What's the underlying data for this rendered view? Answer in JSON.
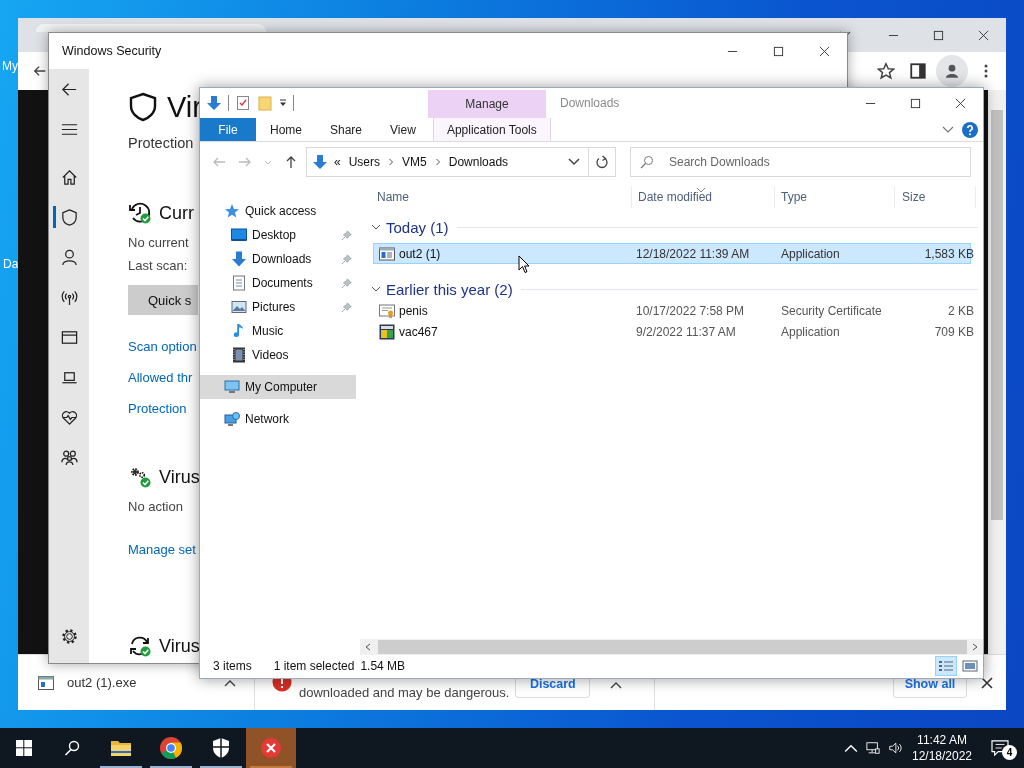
{
  "desktop": {
    "icon_labels": [
      "My",
      "Da"
    ]
  },
  "browser": {
    "download_bar": {
      "file_name": "out2 (1).exe",
      "warning": "downloaded and may be dangerous.",
      "discard": "Discard",
      "show_all": "Show all"
    }
  },
  "security": {
    "title": "Windows Security",
    "nav": [
      {
        "kind": "home",
        "selected": false
      },
      {
        "kind": "shield",
        "selected": true
      },
      {
        "kind": "person",
        "selected": false
      },
      {
        "kind": "antenna",
        "selected": false
      },
      {
        "kind": "window",
        "selected": false
      },
      {
        "kind": "laptop",
        "selected": false
      },
      {
        "kind": "heart",
        "selected": false
      },
      {
        "kind": "family",
        "selected": false
      }
    ],
    "heading": "Vir",
    "subtitle": "Protection",
    "sections": [
      {
        "kind": "history",
        "title": "Curr",
        "lines": [
          "No current",
          "Last scan:"
        ],
        "button": "Quick s",
        "links": [
          "Scan option",
          "Allowed thr",
          "Protection"
        ]
      },
      {
        "kind": "gears",
        "title": "Virus",
        "lines": [
          "No action"
        ],
        "links": [
          "Manage set"
        ]
      },
      {
        "kind": "sync",
        "title": "Virus"
      }
    ]
  },
  "explorer": {
    "title": "Downloads",
    "context_group": "Manage",
    "ribbon_tabs": [
      {
        "label": "File",
        "kind": "file"
      },
      {
        "label": "Home",
        "kind": "plain"
      },
      {
        "label": "Share",
        "kind": "plain"
      },
      {
        "label": "View",
        "kind": "plain"
      },
      {
        "label": "Application Tools",
        "kind": "context"
      }
    ],
    "address": {
      "overflow": "«",
      "path": [
        "Users",
        "VM5",
        "Downloads"
      ]
    },
    "search": {
      "placeholder": "Search Downloads"
    },
    "nav": [
      {
        "label": "Quick access",
        "kind": "star",
        "selected": false,
        "children": [
          {
            "label": "Desktop",
            "kind": "desktop",
            "pinned": true,
            "selected": false
          },
          {
            "label": "Downloads",
            "kind": "download",
            "pinned": true,
            "selected": false
          },
          {
            "label": "Documents",
            "kind": "document",
            "pinned": true,
            "selected": false
          },
          {
            "label": "Pictures",
            "kind": "picture",
            "pinned": true,
            "selected": false
          },
          {
            "label": "Music",
            "kind": "music",
            "pinned": false,
            "selected": false
          },
          {
            "label": "Videos",
            "kind": "video",
            "pinned": false,
            "selected": false
          }
        ]
      },
      {
        "label": "My Computer",
        "kind": "computer",
        "selected": true
      },
      {
        "label": "Network",
        "kind": "network",
        "selected": false
      }
    ],
    "columns": [
      {
        "label": "Name",
        "sorted": false
      },
      {
        "label": "Date modified",
        "sorted": true
      },
      {
        "label": "Type",
        "sorted": false
      },
      {
        "label": "Size",
        "sorted": false
      }
    ],
    "groups": [
      {
        "title": "Today (1)",
        "expanded": true,
        "files": [
          {
            "name": "out2 (1)",
            "date": "12/18/2022 11:39 AM",
            "type": "Application",
            "size": "1,583 KB",
            "kind": "app",
            "selected": true
          }
        ]
      },
      {
        "title": "Earlier this year (2)",
        "expanded": true,
        "files": [
          {
            "name": "penis",
            "date": "10/17/2022 7:58 PM",
            "type": "Security Certificate",
            "size": "2 KB",
            "kind": "certificate",
            "selected": false
          },
          {
            "name": "vac467",
            "date": "9/2/2022 11:37 AM",
            "type": "Application",
            "size": "709 KB",
            "kind": "program",
            "selected": false
          }
        ]
      }
    ],
    "status": {
      "count": "3 items",
      "selection": "1 item selected",
      "size": "1.54 MB"
    },
    "views": [
      {
        "kind": "details",
        "selected": true
      },
      {
        "kind": "thumbnails",
        "selected": false
      }
    ]
  },
  "taskbar": {
    "apps": [
      {
        "kind": "explorer",
        "running": true,
        "active": false
      },
      {
        "kind": "chrome",
        "running": true,
        "active": false
      },
      {
        "kind": "security",
        "running": true,
        "active": false
      },
      {
        "kind": "error",
        "running": true,
        "active": true
      }
    ],
    "clock": {
      "time": "11:42 AM",
      "date": "12/18/2022"
    },
    "notifications": "4"
  }
}
